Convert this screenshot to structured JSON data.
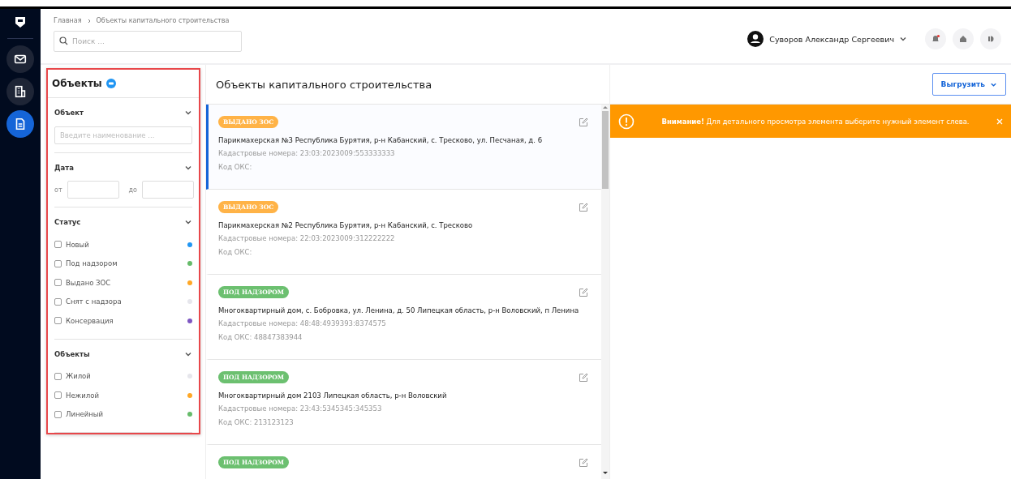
{
  "nav": [
    {
      "selected": false
    },
    {
      "selected": false
    },
    {
      "selected": true
    }
  ],
  "breadcrumbs": [
    "Главная",
    "Объекты капитального строительства"
  ],
  "search": {
    "placeholder": "Поиск ..."
  },
  "user": {
    "name": "Суворов Александр Сергеевич"
  },
  "filters": {
    "title": "Объекты",
    "sections": [
      {
        "kind": "text",
        "title": "Объект",
        "expanded": true,
        "placeholder": "Введите наименование ..."
      },
      {
        "kind": "range",
        "title": "Дата",
        "expanded": true,
        "from_label": "от",
        "to_label": "до"
      },
      {
        "kind": "checks",
        "title": "Статус",
        "expanded": true,
        "options": [
          {
            "label": "Новый",
            "checked": false,
            "color": "#2196f3"
          },
          {
            "label": "Под надзором",
            "checked": false,
            "color": "#66bb6a"
          },
          {
            "label": "Выдано ЗОС",
            "checked": false,
            "color": "#ffa726"
          },
          {
            "label": "Снят с надзора",
            "checked": false,
            "color": "#e6e6ec"
          },
          {
            "label": "Консервация",
            "checked": false,
            "color": "#7e57c2"
          }
        ]
      },
      {
        "kind": "checks",
        "title": "Объекты",
        "expanded": true,
        "options": [
          {
            "label": "Жилой",
            "checked": false,
            "color": "#e6e6ec"
          },
          {
            "label": "Нежилой",
            "checked": false,
            "color": "#ffa726"
          },
          {
            "label": "Линейный",
            "checked": false,
            "color": "#66bb6a"
          }
        ]
      }
    ]
  },
  "list": {
    "title": "Объекты капитального строительства",
    "export_button": "Выгрузить",
    "items": [
      {
        "status": "ВЫДАНО ЗОС",
        "kind": "issued",
        "selected": true,
        "title": "Парикмахерская №3 Республика Бурятия, р-н Кабанский, с. Тресково, ул. Песчаная, д. 6",
        "cadastral": "Кадастровые номера: 23:03:2023009:553333333",
        "code": "Код ОКС:"
      },
      {
        "status": "ВЫДАНО ЗОС",
        "kind": "issued",
        "selected": false,
        "title": "Парикмахерская №2 Республика Бурятия, р-н Кабанский, с. Тресково",
        "cadastral": "Кадастровые номера: 22:03:2023009:312222222",
        "code": "Код ОКС:"
      },
      {
        "status": "ПОД НАДЗОРОМ",
        "kind": "supervised",
        "selected": false,
        "title": "Многоквартирный дом, с. Бобровка, ул. Ленина, д. 50 Липецкая область, р-н Воловский, п Ленина",
        "cadastral": "Кадастровые номера: 48:48:4939393:8374575",
        "code": "Код ОКС: 48847383944"
      },
      {
        "status": "ПОД НАДЗОРОМ",
        "kind": "supervised",
        "selected": false,
        "title": "Многоквартирный дом 2103 Липецкая область, р-н Воловский",
        "cadastral": "Кадастровые номера: 23:43:5345345:345353",
        "code": "Код ОКС: 213123123"
      },
      {
        "status": "ПОД НАДЗОРОМ",
        "kind": "supervised",
        "selected": false
      }
    ]
  },
  "alert": {
    "text": "**Внимание!** Для детального просмотра элемента выберите нужный элемент слева."
  }
}
